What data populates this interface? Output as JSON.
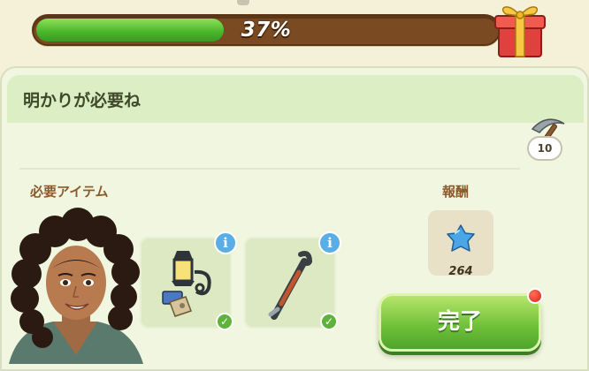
{
  "progress": {
    "percent_text": "37%",
    "fraction": 0.37
  },
  "panel": {
    "title": "明かりが必要ね",
    "pick_count": "10",
    "required_label": "必要アイテム",
    "reward_label": "報酬",
    "items": [
      {
        "icon": "street-lamp-icon",
        "info": "i",
        "check": "✓"
      },
      {
        "icon": "crowbar-icon",
        "info": "i",
        "check": "✓"
      }
    ],
    "reward": {
      "icon": "blue-star-gem-icon",
      "value": "264"
    },
    "complete_label": "完了"
  },
  "colors": {
    "progress_fill": "#47b52a",
    "progress_track": "#7a4a22",
    "complete_button": "#72c23b",
    "info_badge": "#5aaee6",
    "notification": "#d9261a"
  }
}
